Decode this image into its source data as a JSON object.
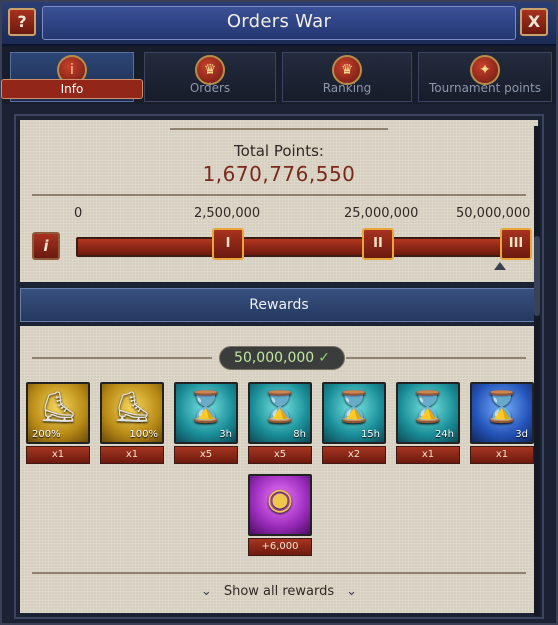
{
  "window": {
    "title": "Orders War",
    "help_label": "?",
    "close_label": "X"
  },
  "tabs": [
    {
      "label": "Info",
      "icon": "info-icon",
      "glyph": "i",
      "active": true
    },
    {
      "label": "Orders",
      "icon": "trophy-icon",
      "glyph": "♛",
      "active": false
    },
    {
      "label": "Ranking",
      "icon": "trophy-icon",
      "glyph": "♛",
      "active": false
    },
    {
      "label": "Tournament points",
      "icon": "tournament-icon",
      "glyph": "✦",
      "active": false
    }
  ],
  "total_points": {
    "label": "Total Points:",
    "value": "1,670,776,550"
  },
  "progress": {
    "info_label": "i",
    "thresholds": [
      "0",
      "2,500,000",
      "25,000,000",
      "50,000,000"
    ],
    "tiers": [
      "I",
      "II",
      "III"
    ]
  },
  "rewards": {
    "header": "Rewards",
    "selected_tier": "50,000,000",
    "items": [
      {
        "icon": "boots-icon",
        "rarity": "gold",
        "glyph": "⛸",
        "tag": "200%",
        "tag_side": "left",
        "qty": "x1"
      },
      {
        "icon": "boots-icon",
        "rarity": "gold",
        "glyph": "⛸",
        "tag": "100%",
        "tag_side": "right",
        "qty": "x1"
      },
      {
        "icon": "hourglass-icon",
        "rarity": "teal",
        "glyph": "⌛",
        "tag": "3h",
        "tag_side": "right",
        "qty": "x5"
      },
      {
        "icon": "hourglass-icon",
        "rarity": "teal",
        "glyph": "⌛",
        "tag": "8h",
        "tag_side": "right",
        "qty": "x5"
      },
      {
        "icon": "hourglass-icon",
        "rarity": "teal",
        "glyph": "⌛",
        "tag": "15h",
        "tag_side": "right",
        "qty": "x2"
      },
      {
        "icon": "hourglass-icon",
        "rarity": "teal",
        "glyph": "⌛",
        "tag": "24h",
        "tag_side": "right",
        "qty": "x1"
      },
      {
        "icon": "hourglass-icon",
        "rarity": "blue",
        "glyph": "⌛",
        "tag": "3d",
        "tag_side": "right",
        "qty": "x1"
      },
      {
        "icon": "gold-coins-icon",
        "rarity": "purple",
        "glyph": "◉",
        "tag": "",
        "tag_side": "right",
        "qty": "+6,000"
      }
    ],
    "show_all_label": "Show all rewards"
  }
}
